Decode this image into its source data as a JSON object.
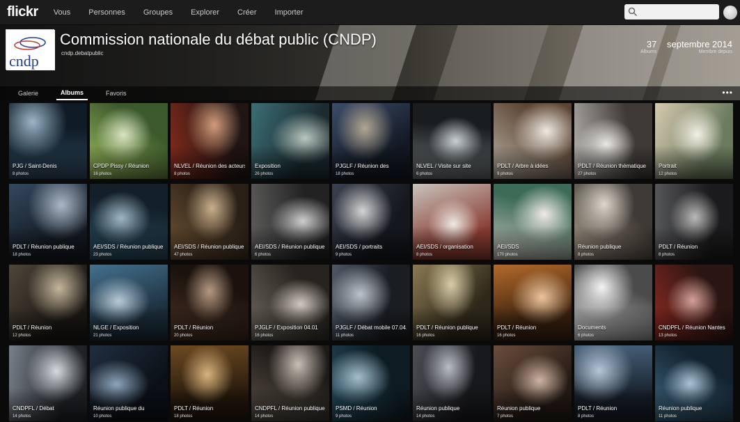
{
  "topnav": {
    "logo": "flickr",
    "links": [
      "Vous",
      "Personnes",
      "Groupes",
      "Explorer",
      "Créer",
      "Importer"
    ],
    "search_placeholder": ""
  },
  "cover": {
    "title": "Commission nationale du débat public (CNDP)",
    "subtitle": "cndp.debatpublic",
    "buddy_text": "cndp",
    "stats": [
      {
        "value": "37",
        "label": "Albums"
      },
      {
        "value": "septembre 2014",
        "label": "Membre depuis"
      }
    ],
    "tabs": [
      "Galerie",
      "Albums",
      "Favoris"
    ],
    "active_tab": 1,
    "more": "•••"
  },
  "albums": [
    {
      "title": "PJG / Saint-Denis",
      "count": "8 photos",
      "colors": [
        "#30495f",
        "#0e1a24",
        "#9bb6c8"
      ]
    },
    {
      "title": "CPDP Pissy / Réunion",
      "count": "16 photos",
      "colors": [
        "#9dbe5e",
        "#3d5a2c",
        "#d9e4c1"
      ]
    },
    {
      "title": "NLVEL / Réunion des acteurs",
      "count": "8 photos",
      "colors": [
        "#8b2c1c",
        "#1f1512",
        "#d39b7c"
      ]
    },
    {
      "title": "Exposition",
      "count": "26 photos",
      "colors": [
        "#3c6e75",
        "#1b2b30",
        "#b9c7c0"
      ]
    },
    {
      "title": "PJGLF / Réunion des",
      "count": "18 photos",
      "colors": [
        "#3b4d6b",
        "#121822",
        "#b3a692"
      ]
    },
    {
      "title": "NLVEL / Visite sur site",
      "count": "6 photos",
      "colors": [
        "#6e7578",
        "#1a1d1f",
        "#c7cfd2"
      ]
    },
    {
      "title": "PDLT / Arbre à idées",
      "count": "9 photos",
      "colors": [
        "#b9b1a4",
        "#5b4433",
        "#efeae2"
      ]
    },
    {
      "title": "PDLT / Réunion thématique",
      "count": "27 photos",
      "colors": [
        "#b4b2ad",
        "#403a36",
        "#e9e7e3"
      ]
    },
    {
      "title": "Portrait",
      "count": "12 photos",
      "colors": [
        "#d6cab0",
        "#6b7b5e",
        "#f3efe5"
      ]
    },
    {
      "title": "PDLT / Réunion publique",
      "count": "18 photos",
      "colors": [
        "#34485e",
        "#131a22",
        "#a9b7c6"
      ]
    },
    {
      "title": "AEI/SDS / Réunion publique",
      "count": "23 photos",
      "colors": [
        "#2d5064",
        "#132029",
        "#9eb5c4"
      ]
    },
    {
      "title": "AEI/SDS / Réunion publique",
      "count": "47 photos",
      "colors": [
        "#6f5536",
        "#2b2016",
        "#c9b08c"
      ]
    },
    {
      "title": "AEI/SDS / Réunion publique",
      "count": "6 photos",
      "colors": [
        "#5d5d5c",
        "#222",
        "#cfcfcf"
      ]
    },
    {
      "title": "AEI/SDS / portraits",
      "count": "9 photos",
      "colors": [
        "#3a4150",
        "#14171d",
        "#d4d4d4"
      ]
    },
    {
      "title": "AEI/SDS / organisation",
      "count": "8 photos",
      "colors": [
        "#c8c3bc",
        "#8a3d33",
        "#eeeae4"
      ]
    },
    {
      "title": "AEI/SDS",
      "count": "170 photos",
      "colors": [
        "#c9c4bd",
        "#3c6b58",
        "#efebe6"
      ]
    },
    {
      "title": "Réunion publique",
      "count": "8 photos",
      "colors": [
        "#a79a88",
        "#3e3a35",
        "#ddd6cb"
      ]
    },
    {
      "title": "PDLT / Réunion",
      "count": "8 photos",
      "colors": [
        "#565759",
        "#1b1b1d",
        "#bababa"
      ]
    },
    {
      "title": "PDLT / Réunion",
      "count": "12 photos",
      "colors": [
        "#4f4639",
        "#1b1713",
        "#c4b59c"
      ]
    },
    {
      "title": "NLGE / Exposition",
      "count": "21 photos",
      "colors": [
        "#44708e",
        "#1b2c38",
        "#b7cad8"
      ]
    },
    {
      "title": "PDLT / Réunion",
      "count": "20 photos",
      "colors": [
        "#4a3325",
        "#1b120d",
        "#b59a83"
      ]
    },
    {
      "title": "PJGLF / Exposition 04.01",
      "count": "16 photos",
      "colors": [
        "#6d6860",
        "#27241f",
        "#cfc9bf"
      ]
    },
    {
      "title": "PJGLF / Débat mobile 07.04.15",
      "count": "11 photos",
      "colors": [
        "#4e5764",
        "#1a1d21",
        "#bcc3cc"
      ]
    },
    {
      "title": "PDLT / Réunion publique",
      "count": "16 photos",
      "colors": [
        "#8a7a52",
        "#2e281b",
        "#d7cba8"
      ]
    },
    {
      "title": "PDLT / Réunion",
      "count": "16 photos",
      "colors": [
        "#b46a2b",
        "#3a220f",
        "#eac59d"
      ]
    },
    {
      "title": "Documents",
      "count": "6 photos",
      "colors": [
        "#cfcfcf",
        "#4b4b4b",
        "#f4f4f4"
      ]
    },
    {
      "title": "CNDPFL / Réunion Nantes",
      "count": "13 photos",
      "colors": [
        "#8f2a22",
        "#2a1512",
        "#d2a199"
      ]
    },
    {
      "title": "CNDPFL / Débat",
      "count": "14 photos",
      "colors": [
        "#77808a",
        "#1f2226",
        "#d6dbe0"
      ]
    },
    {
      "title": "Réunion publique du",
      "count": "10 photos",
      "colors": [
        "#1f2e3f",
        "#0b1016",
        "#8da4bb"
      ]
    },
    {
      "title": "PDLT / Réunion",
      "count": "18 photos",
      "colors": [
        "#6e4a22",
        "#22170b",
        "#d8b47c"
      ]
    },
    {
      "title": "CNDPFL / Réunion publique",
      "count": "14 photos",
      "colors": [
        "#5a5148",
        "#1d1a17",
        "#c8bfb4"
      ]
    },
    {
      "title": "PSMD / Réunion",
      "count": "9 photos",
      "colors": [
        "#254b5e",
        "#0d1b22",
        "#a4bfcc"
      ]
    },
    {
      "title": "Réunion publique",
      "count": "14 photos",
      "colors": [
        "#4b4e55",
        "#17181b",
        "#b8bcc4"
      ]
    },
    {
      "title": "Réunion publique",
      "count": "7 photos",
      "colors": [
        "#6b4d3d",
        "#231a14",
        "#cdb3a3"
      ]
    },
    {
      "title": "PDLT / Réunion",
      "count": "8 photos",
      "colors": [
        "#46607a",
        "#151d26",
        "#b5c6d6"
      ]
    },
    {
      "title": "Réunion publique",
      "count": "11 photos",
      "colors": [
        "#3e6883",
        "#142330",
        "#aac3d3"
      ]
    }
  ]
}
